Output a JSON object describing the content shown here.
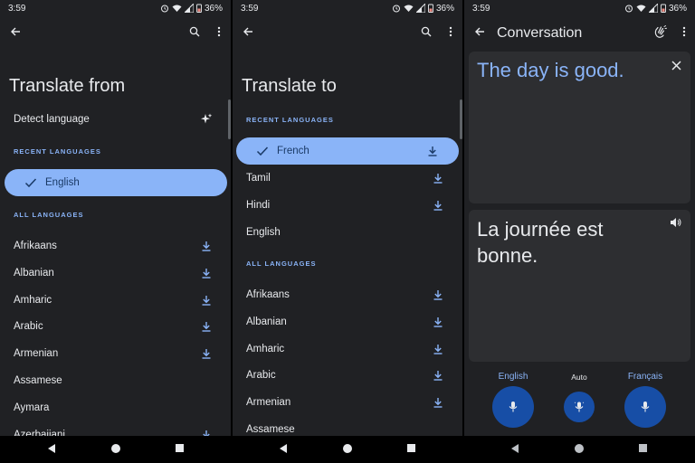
{
  "status": {
    "time": "3:59",
    "battery": "36%"
  },
  "panel1": {
    "title": "Translate from",
    "detect": "Detect language",
    "recent_header": "RECENT LANGUAGES",
    "selected": "English",
    "all_header": "ALL LANGUAGES",
    "languages": [
      "Afrikaans",
      "Albanian",
      "Amharic",
      "Arabic",
      "Armenian",
      "Assamese",
      "Aymara",
      "Azerbaijani"
    ]
  },
  "panel2": {
    "title": "Translate to",
    "recent_header": "RECENT LANGUAGES",
    "selected": "French",
    "recent": [
      "Tamil",
      "Hindi",
      "English"
    ],
    "all_header": "ALL LANGUAGES",
    "languages": [
      "Afrikaans",
      "Albanian",
      "Amharic",
      "Arabic",
      "Armenian",
      "Assamese"
    ]
  },
  "panel3": {
    "title": "Conversation",
    "source_text": "The day is good.",
    "translated_text": "La journée est bonne.",
    "lang_left": "English",
    "lang_center": "Auto",
    "lang_right": "Français"
  },
  "colors": {
    "bg": "#202124",
    "accent": "#8ab4f8",
    "card": "#2d2e31",
    "mic": "#174ea6"
  }
}
